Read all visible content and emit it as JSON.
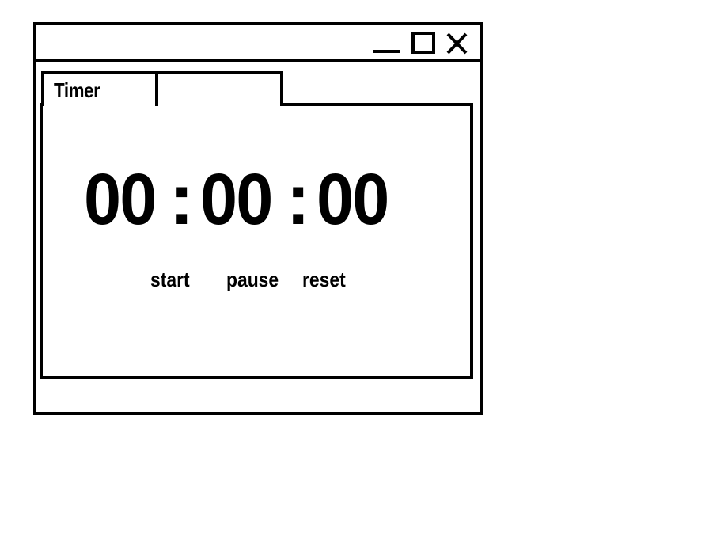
{
  "window": {
    "controls": {
      "minimize_icon": "minimize-icon",
      "maximize_icon": "maximize-icon",
      "close_icon": "close-icon"
    }
  },
  "tabs": [
    {
      "label": "Timer",
      "active": true
    },
    {
      "label": "",
      "active": false
    }
  ],
  "timer": {
    "hours": "00",
    "minutes": "00",
    "seconds": "00",
    "separator": ":"
  },
  "buttons": {
    "start_label": "start",
    "pause_label": "pause",
    "reset_label": "reset"
  }
}
